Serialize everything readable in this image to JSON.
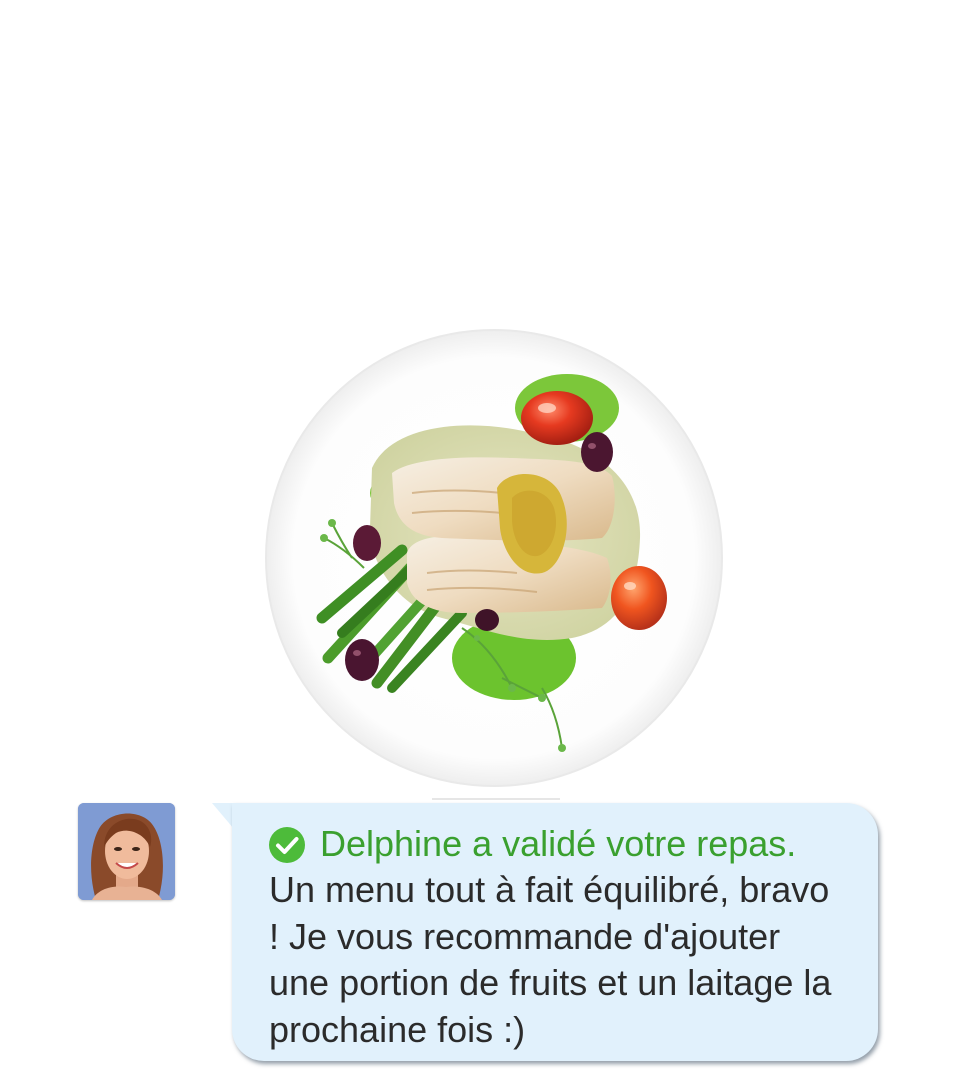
{
  "chat": {
    "validated_text": "Delphine a validé votre repas.",
    "message_text": "Un menu tout à fait équilibré, bravo ! Je vous recommande d'ajouter une portion de fruits et un laitage la prochaine fois :)"
  },
  "colors": {
    "validated_green": "#3aa02f",
    "check_circle": "#4dbb3a",
    "bubble_background": "#e1f1fc",
    "message_text": "#2b2b2b"
  },
  "icons": {
    "check": "check-circle-icon",
    "avatar": "nutritionist-avatar",
    "meal": "meal-photo"
  }
}
